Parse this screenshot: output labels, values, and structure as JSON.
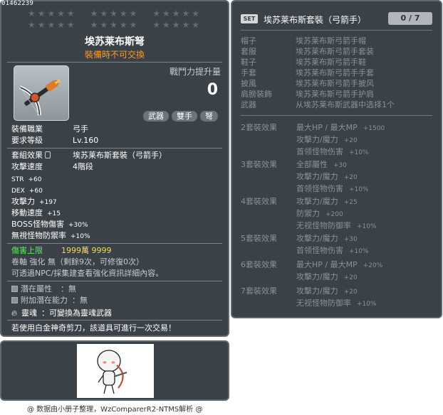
{
  "item_id": "01462239",
  "item": {
    "star_rows": [
      [
        "★★★★★",
        "★★★★★",
        "★★★★★"
      ],
      [
        "★★★★★",
        "★★★★★",
        "★★★★★"
      ]
    ],
    "name": "埃苏莱布斯弩",
    "trade_note": "裝備時不可交換",
    "combat_power_label": "戰鬥力提升量",
    "combat_power_value": "0",
    "tags": [
      "武器",
      "雙手",
      "弩"
    ],
    "job_label": "裝備職業",
    "job_value": "弓手",
    "level_label": "要求等級",
    "level_value": "Lv.160",
    "set_effect_label": "套組效果",
    "set_effect_value": "埃苏莱布斯套裝（弓箭手）",
    "attack_speed_label": "攻擊速度",
    "attack_speed_value": "4階段",
    "stats": [
      {
        "k": "STR",
        "v": "+60"
      },
      {
        "k": "DEX",
        "v": "+60"
      },
      {
        "k": "攻擊力",
        "v": "+197"
      },
      {
        "k": "移動速度",
        "v": "+15"
      },
      {
        "k": "BOSS怪物傷害",
        "v": "+30%"
      },
      {
        "k": "無視怪物防禦率",
        "v": "+10%"
      }
    ],
    "damage_cap_label": "傷害上限",
    "damage_cap_value": "1999萬 9999",
    "scroll_line": "卷軸 強化 無（剩餘9次，可修復0次）",
    "npc_line": "可透過NPC/採集建查看強化資訊詳細內容。",
    "potential_label": "潛在屬性",
    "potential_value": "：無",
    "add_potential_label": "附加潛在能力",
    "add_potential_value": "：無",
    "soul_label": "靈魂",
    "soul_value": "：可變換為靈魂武器",
    "scissors_line": "若使用白金神奇剪刀，該道具可進行一次交易！"
  },
  "set_panel": {
    "badge": "SET",
    "title": "埃苏莱布斯套裝（弓箭手）",
    "count": "0 / 7",
    "pieces": [
      {
        "k": "帽子",
        "v": "埃苏莱布斯弓箭手帽"
      },
      {
        "k": "套服",
        "v": "埃苏莱布斯弓箭手套装"
      },
      {
        "k": "鞋子",
        "v": "埃苏莱布斯弓箭手鞋"
      },
      {
        "k": "手套",
        "v": "埃苏莱布斯弓箭手手套"
      },
      {
        "k": "披風",
        "v": "埃苏莱布斯弓箭手披风"
      },
      {
        "k": "肩膀裝飾",
        "v": "埃苏莱布斯弓箭手护肩"
      },
      {
        "k": "武器",
        "v": "从埃苏莱布斯武器中选择1个"
      }
    ],
    "bonuses": [
      {
        "label": "2套裝效果",
        "effects": [
          {
            "t": "最大HP / 最大MP",
            "n": "+1500"
          },
          {
            "t": "攻擊力/魔力",
            "n": "+20"
          },
          {
            "t": "首领怪物伤害",
            "n": "+10%"
          }
        ]
      },
      {
        "label": "3套裝效果",
        "effects": [
          {
            "t": "全部屬性",
            "n": "+30"
          },
          {
            "t": "攻擊力/魔力",
            "n": "+20"
          },
          {
            "t": "首领怪物伤害",
            "n": "+10%"
          }
        ]
      },
      {
        "label": "4套裝效果",
        "effects": [
          {
            "t": "攻擊力/魔力",
            "n": "+25"
          },
          {
            "t": "防禦力",
            "n": "+200"
          },
          {
            "t": "无视怪物防御率",
            "n": "+10%"
          }
        ]
      },
      {
        "label": "5套裝效果",
        "effects": [
          {
            "t": "攻擊力/魔力",
            "n": "+30"
          },
          {
            "t": "首领怪物伤害",
            "n": "+10%"
          }
        ]
      },
      {
        "label": "6套裝效果",
        "effects": [
          {
            "t": "最大HP / 最大MP",
            "n": "+20%"
          },
          {
            "t": "攻擊力/魔力",
            "n": "+20"
          }
        ]
      },
      {
        "label": "7套裝效果",
        "effects": [
          {
            "t": "攻擊力/魔力",
            "n": "+20"
          },
          {
            "t": "无视怪物防御率",
            "n": "+10%"
          }
        ]
      }
    ]
  },
  "credit": "@ 数据由小册子整理，WzComparerR2-NTMS解析 @"
}
